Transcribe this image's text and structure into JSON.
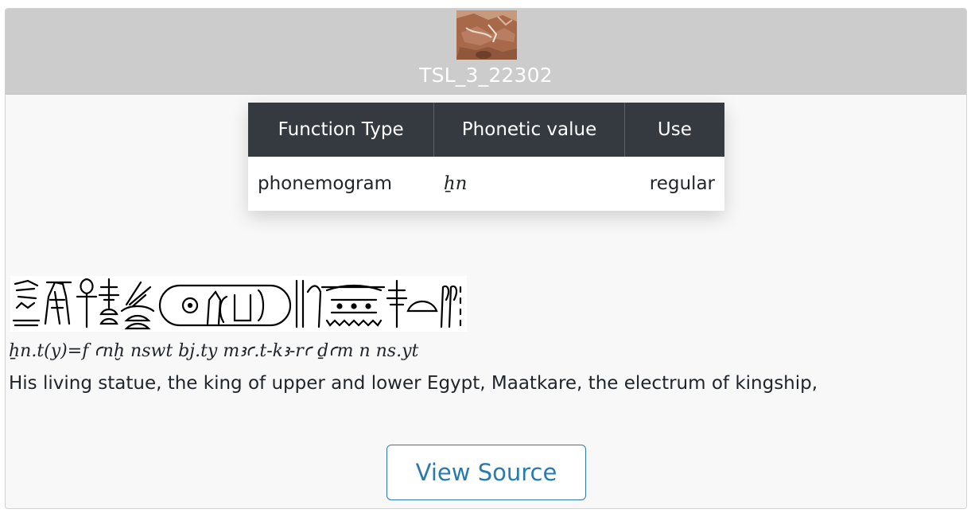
{
  "sign": {
    "title": "TSL_3_22302",
    "image_icon": "sign-photo-thumbnail"
  },
  "values_table": {
    "headers": [
      "Function Type",
      "Phonetic value",
      "Use"
    ],
    "rows": [
      {
        "function_type": "phonemogram",
        "phonetic_value": "ẖn",
        "use": "regular"
      }
    ]
  },
  "example": {
    "hieroglyphs_icon": "hieroglyphic-inscription",
    "transliteration": "ẖn.t(y)=f ꜥnḫ nswt bj.ty mꜣꜥ.t-kꜣ-rꜥ ḏꜥm n ns.yt",
    "translation": "His living statue, the king of upper and lower Egypt, Maatkare, the electrum of kingship,"
  },
  "actions": {
    "view_source_label": "View Source"
  },
  "colors": {
    "header_bg": "#cccccc",
    "table_header_bg": "#343a40",
    "link_blue": "#2a7ab0"
  }
}
